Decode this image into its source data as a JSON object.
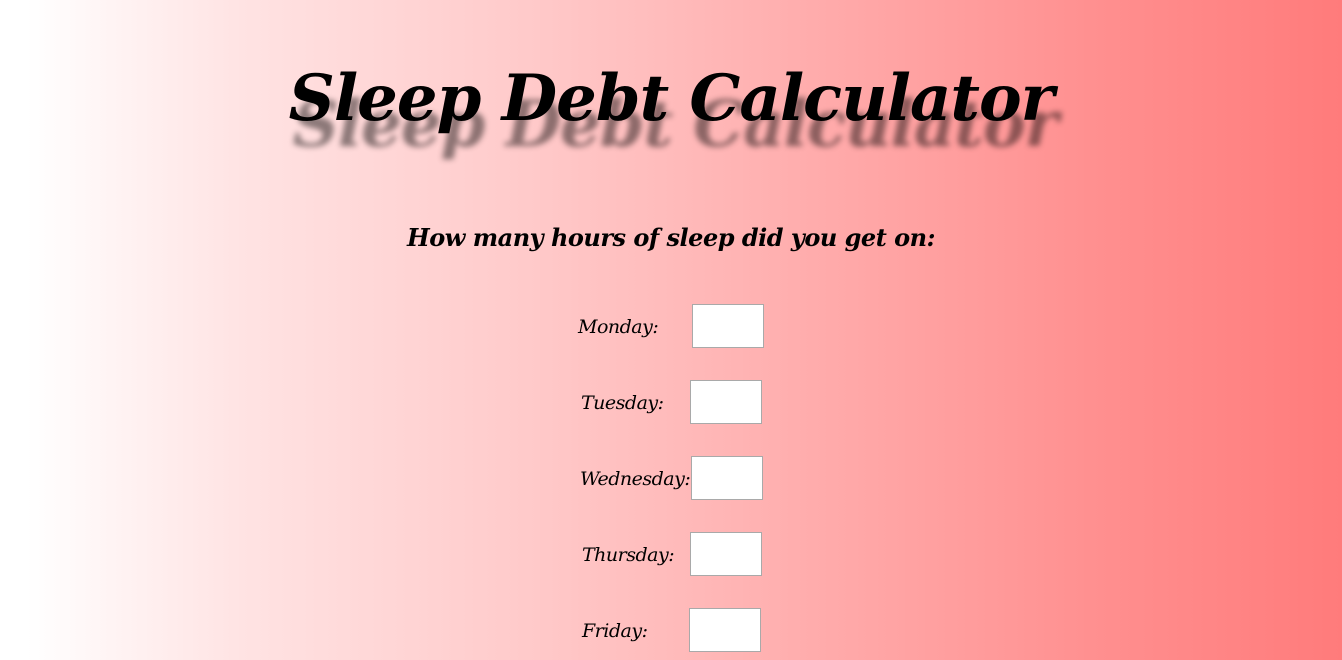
{
  "page": {
    "title": "Sleep Debt Calculator",
    "question": "How many hours of sleep did you get on:"
  },
  "days": [
    {
      "label": "Monday:",
      "value": ""
    },
    {
      "label": "Tuesday:",
      "value": ""
    },
    {
      "label": "Wednesday:",
      "value": ""
    },
    {
      "label": "Thursday:",
      "value": ""
    },
    {
      "label": "Friday:",
      "value": ""
    }
  ],
  "colors": {
    "gradient_start": "#ffffff",
    "gradient_end": "#ff7b7b",
    "text": "#000000",
    "input_border": "#a9a9a9"
  }
}
